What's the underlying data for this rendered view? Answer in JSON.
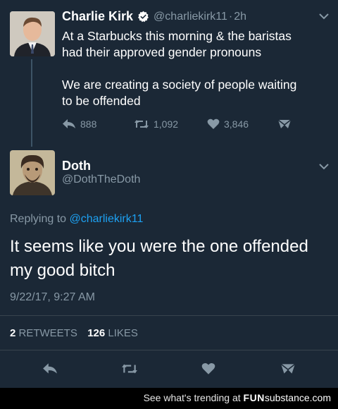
{
  "tweet1": {
    "display_name": "Charlie Kirk",
    "handle": "@charliekirk11",
    "separator": "·",
    "age": "2h",
    "paragraph1_line1": "At a Starbucks this morning & the baristas",
    "paragraph1_line2": "had their approved gender pronouns",
    "paragraph2_line1": "We are creating a society of people waiting",
    "paragraph2_line2": "to be offended",
    "reply_count": "888",
    "retweet_count": "1,092",
    "like_count": "3,846"
  },
  "tweet2": {
    "display_name": "Doth",
    "handle": "@DothTheDoth",
    "replying_to_label": "Replying to",
    "replying_to_handle": "@charliekirk11",
    "text_line1": "It seems like you were the one offended",
    "text_line2": "my good bitch",
    "timestamp": "9/22/17, 9:27 AM",
    "retweets_value": "2",
    "retweets_label": "RETWEETS",
    "likes_value": "126",
    "likes_label": "LIKES"
  },
  "footer": {
    "text": "See what's trending at",
    "brand_prefix": "FUN",
    "brand_suffix": "substance.com"
  },
  "colors": {
    "background": "#1b2836",
    "secondary_text": "#8899a6",
    "link": "#1da1f2",
    "verified_badge": "#ffffff"
  },
  "icons": {
    "verified": "verified-badge-icon",
    "reply": "reply-icon",
    "retweet": "retweet-icon",
    "like": "heart-icon",
    "dm": "direct-message-icon",
    "more": "chevron-down-icon"
  }
}
